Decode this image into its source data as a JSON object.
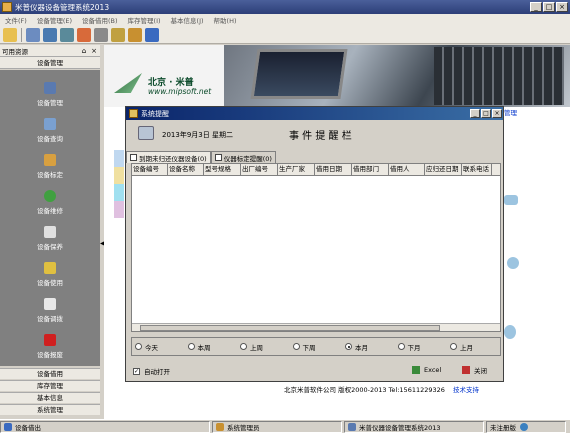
{
  "window": {
    "title": "米普仪器设备管理系统2013"
  },
  "menu": [
    "文件(F)",
    "设备管理(E)",
    "设备借用(B)",
    "库存管理(I)",
    "基本信息(J)",
    "帮助(H)"
  ],
  "toolbar": {
    "icons": [
      "folder-icon",
      "list-icon",
      "book-icon",
      "monitor-icon",
      "home-icon",
      "print-icon",
      "tools-icon",
      "lock-icon",
      "exit-icon"
    ]
  },
  "sidebar": {
    "header": "可用资源",
    "section": "设备管理",
    "items": [
      "设备管理",
      "设备查询",
      "设备标定",
      "设备维修",
      "设备保养",
      "设备使用",
      "设备调拨",
      "设备报废"
    ],
    "bottom": [
      "设备借用",
      "库存管理",
      "基本信息",
      "系统管理"
    ]
  },
  "banner": {
    "company": "北京 · 米普",
    "url": "www.mipsoft.net"
  },
  "background_link": "管理",
  "footer": {
    "text": "北京米普软件公司 版权2000-2013  Tel:15611229326",
    "link": "技术支持"
  },
  "dialog": {
    "title": "系统提醒",
    "date": "2013年9月3日 星期二",
    "heading": "事 件 提 醒 栏",
    "tabs": [
      "到期未归还仪器设备(0)",
      "仪器标定提醒(0)"
    ],
    "columns": [
      "设备编号",
      "设备名称",
      "型号规格",
      "出厂编号",
      "生产厂家",
      "借用日期",
      "借用部门",
      "借用人",
      "应归还日期",
      "联系电话"
    ],
    "periods": [
      "今天",
      "本周",
      "上周",
      "下周",
      "本月",
      "下月",
      "上月"
    ],
    "selected_period": "本月",
    "auto_open_label": "自动打开",
    "auto_open_checked": true,
    "excel_label": "Excel",
    "close_label": "关闭"
  },
  "status": {
    "left": "设备借出",
    "user": "系统管理员",
    "product": "米普仪器设备管理系统2013",
    "license": "未注册版"
  }
}
